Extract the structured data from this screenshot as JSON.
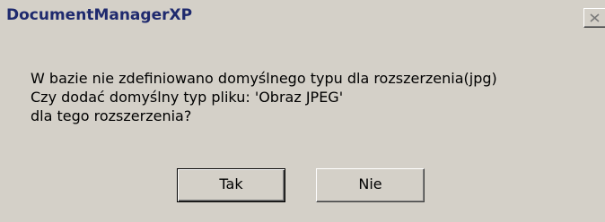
{
  "window": {
    "title": "DocumentManagerXP"
  },
  "message": {
    "lines": [
      "W bazie nie zdefiniowano domyślnego typu dla rozszerzenia(jpg)",
      "Czy dodać domyślny typ pliku: 'Obraz JPEG'",
      "dla tego rozszerzenia?"
    ]
  },
  "buttons": {
    "yes_label": "Tak",
    "no_label": "Nie"
  },
  "icons": {
    "close": "close-icon"
  },
  "colors": {
    "dialog_bg": "#d4d0c8",
    "title_text": "#1f2a6e"
  }
}
